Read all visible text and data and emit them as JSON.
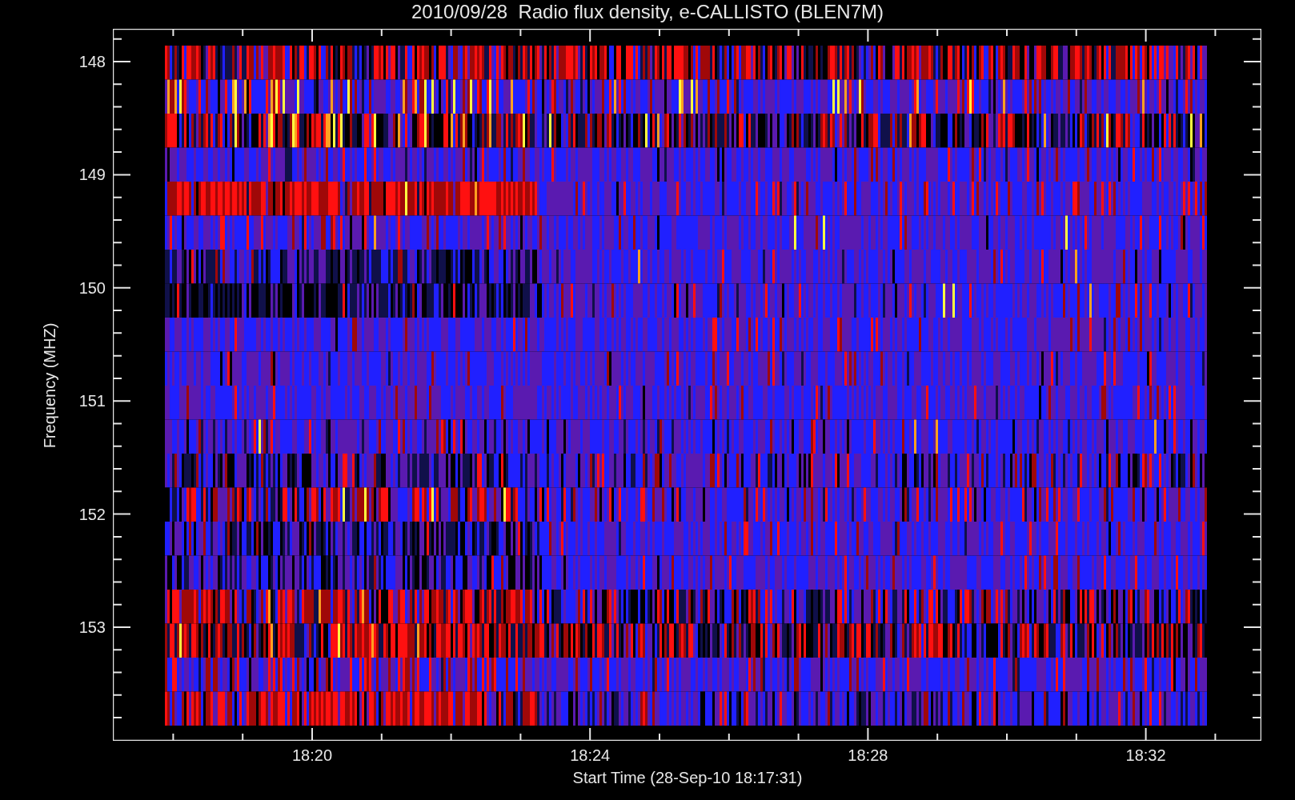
{
  "title": "2010/09/28  Radio flux density, e-CALLISTO (BLEN7M)",
  "y_axis": {
    "label": "Frequency (MHZ)",
    "ticks": [
      "148",
      "149",
      "150",
      "151",
      "152",
      "153"
    ]
  },
  "x_axis": {
    "label": "Start Time (28-Sep-10 18:17:31)",
    "ticks": [
      "18:20",
      "18:24",
      "18:28",
      "18:32"
    ]
  }
}
